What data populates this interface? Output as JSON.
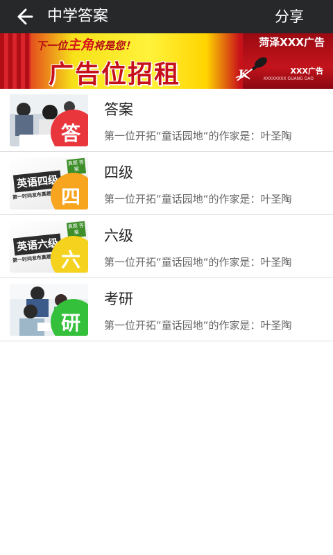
{
  "header": {
    "title": "中学答案",
    "share_label": "分享"
  },
  "banner": {
    "slogan_prefix": "下一位",
    "slogan_emph": "主角",
    "slogan_suffix": "将是您！",
    "headline": "广告位招租",
    "brand": "菏泽XXX广告",
    "logo_text": "XXX广告",
    "logo_sub": "XXXXXXXX GUANG GAO"
  },
  "list": {
    "items": [
      {
        "title": "答案",
        "desc": "第一位开拓“童话园地“的作家是：叶圣陶",
        "badge": "答",
        "badge_color": "#e8363c",
        "thumb_type": "photo-students",
        "thumb_caption": "",
        "thumb_sub": "",
        "thumb_ribbon": ""
      },
      {
        "title": "四级",
        "desc": "第一位开拓“童话园地“的作家是：叶圣陶",
        "badge": "四",
        "badge_color": "#f7a51f",
        "thumb_type": "exam-card",
        "thumb_caption": "英语四级",
        "thumb_sub": "第一时间发布真题",
        "thumb_ribbon": "真题 答案"
      },
      {
        "title": "六级",
        "desc": "第一位开拓“童话园地“的作家是：叶圣陶",
        "badge": "六",
        "badge_color": "#f5d21e",
        "thumb_type": "exam-card",
        "thumb_caption": "英语六级",
        "thumb_sub": "第一时间发布真题",
        "thumb_ribbon": "真题 答案"
      },
      {
        "title": "考研",
        "desc": "第一位开拓“童话园地“的作家是：叶圣陶",
        "badge": "研",
        "badge_color": "#35c03c",
        "thumb_type": "photo-study",
        "thumb_caption": "",
        "thumb_sub": "",
        "thumb_ribbon": ""
      }
    ]
  },
  "icons": {
    "back": "arrow-left-icon"
  }
}
